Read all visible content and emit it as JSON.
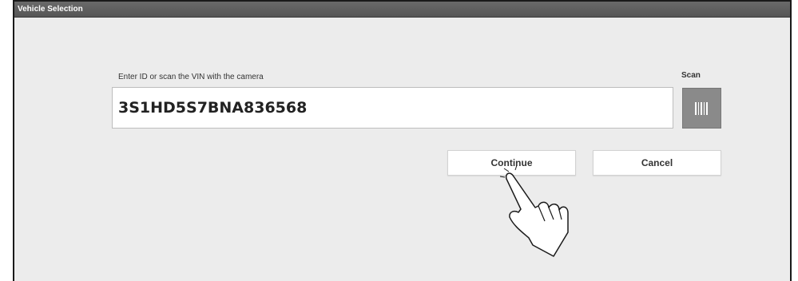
{
  "window": {
    "title": "Vehicle Selection"
  },
  "form": {
    "prompt": "Enter ID or scan the VIN with the camera",
    "vin_value": "3S1HD5S7BNA836568",
    "scan_label": "Scan",
    "scan_button_icon": "barcode-icon"
  },
  "actions": {
    "continue_label": "Continue",
    "cancel_label": "Cancel"
  },
  "overlay": {
    "pointer_icon": "hand-pointer-icon"
  }
}
